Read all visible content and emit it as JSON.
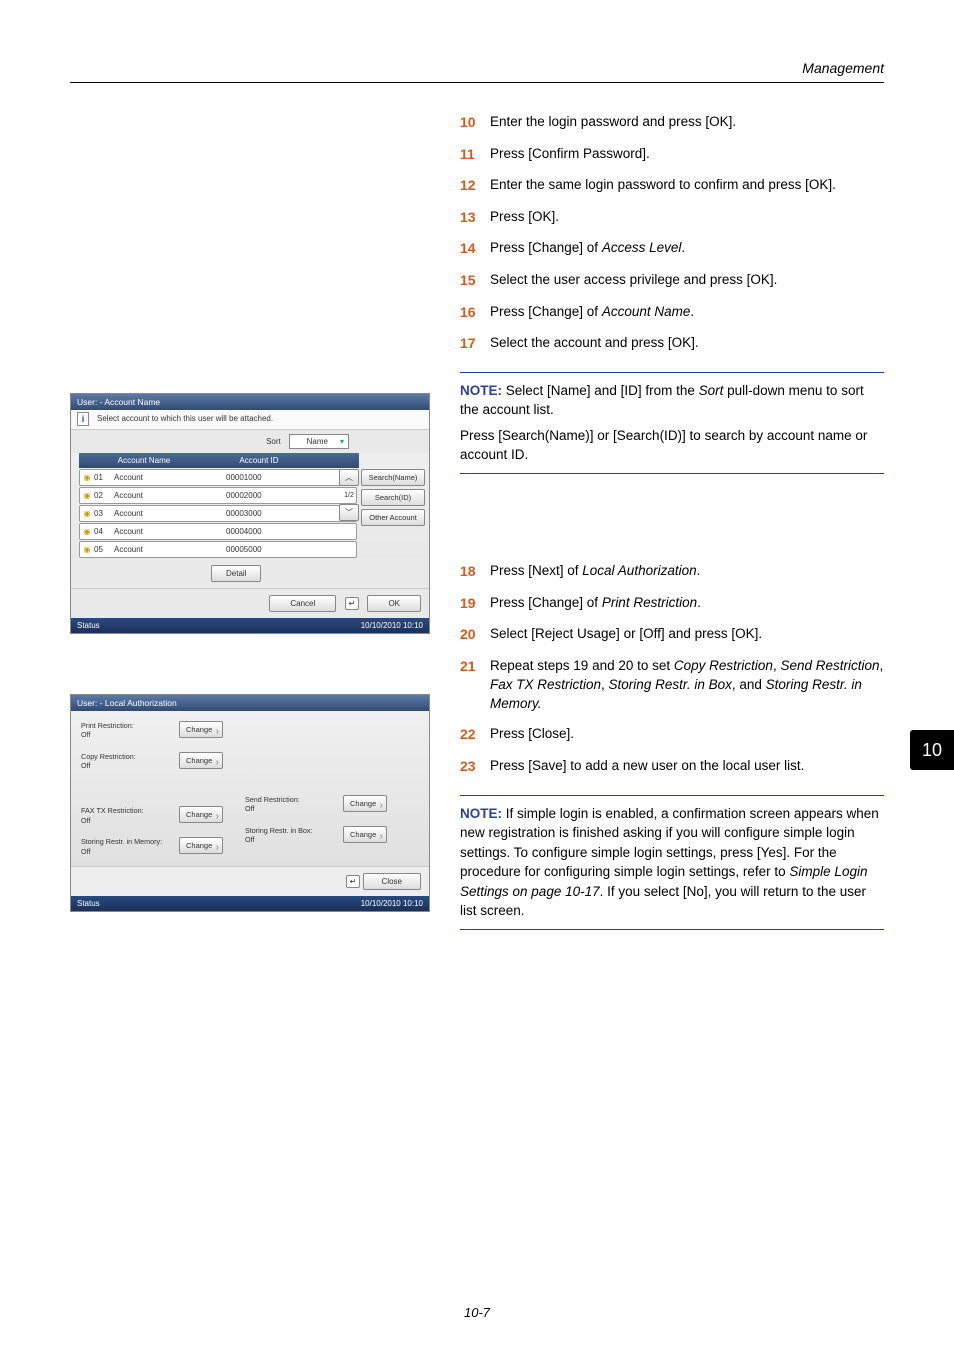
{
  "header": {
    "section": "Management"
  },
  "steps_a": [
    {
      "n": "10",
      "t": "Enter the login password and press [OK]."
    },
    {
      "n": "11",
      "t": "Press [Confirm Password]."
    },
    {
      "n": "12",
      "t": "Enter the same login password to confirm and press [OK]."
    },
    {
      "n": "13",
      "t": "Press [OK]."
    },
    {
      "n": "14",
      "html": "Press [Change] of <span class='italic'>Access Level</span>."
    },
    {
      "n": "15",
      "t": "Select the user access privilege and press [OK]."
    },
    {
      "n": "16",
      "html": "Press [Change] of <span class='italic'>Account Name</span>."
    },
    {
      "n": "17",
      "t": "Select the account and press [OK]."
    }
  ],
  "note1": {
    "label": "NOTE:",
    "l1": "Select [Name] and [ID] from the <span class='italic'>Sort</span> pull-down menu to sort the account list.",
    "l2": "Press [Search(Name)] or [Search(ID)] to search by account name or account ID."
  },
  "steps_b": [
    {
      "n": "18",
      "html": "Press [Next] of <span class='italic'>Local Authorization</span>."
    },
    {
      "n": "19",
      "html": "Press [Change] of <span class='italic'>Print Restriction</span>."
    },
    {
      "n": "20",
      "t": "Select [Reject Usage] or [Off] and press [OK]."
    },
    {
      "n": "21",
      "html": "Repeat steps 19 and 20 to set <span class='italic'>Copy Restriction</span>, <span class='italic'>Send Restriction</span>, <span class='italic'>Fax TX Restriction</span>, <span class='italic'>Storing Restr. in Box</span>, and <span class='italic'>Storing Restr. in Memory.</span>"
    },
    {
      "n": "22",
      "t": "Press [Close]."
    },
    {
      "n": "23",
      "t": "Press [Save] to add a new user on the local user list."
    }
  ],
  "note2": {
    "label": "NOTE:",
    "body": "If simple login is enabled, a confirmation screen appears when new registration is finished asking if you will configure simple login settings. To configure simple login settings, press [Yes]. For the procedure for configuring simple login settings, refer to <span class='italic'>Simple Login Settings on page 10-17</span>. If you select [No], you will return to the user list screen."
  },
  "side_tab": "10",
  "footer": "10-7",
  "dialog1": {
    "title": "User: - Account Name",
    "instruction": "Select account to which this user will be attached.",
    "sort_label": "Sort",
    "sort_value": "Name",
    "col_name": "Account Name",
    "col_id": "Account ID",
    "rows": [
      {
        "num": "01",
        "name": "Account",
        "id": "00001000"
      },
      {
        "num": "02",
        "name": "Account",
        "id": "00002000"
      },
      {
        "num": "03",
        "name": "Account",
        "id": "00003000"
      },
      {
        "num": "04",
        "name": "Account",
        "id": "00004000"
      },
      {
        "num": "05",
        "name": "Account",
        "id": "00005000"
      }
    ],
    "page": "1/2",
    "search_name": "Search(Name)",
    "search_id": "Search(ID)",
    "other_account": "Other Account",
    "detail": "Detail",
    "cancel": "Cancel",
    "ok": "OK",
    "status": "Status",
    "datetime": "10/10/2010   10:10"
  },
  "dialog2": {
    "title": "User: - Local Authorization",
    "items_left": [
      {
        "l1": "Print Restriction:",
        "l2": "Off"
      },
      {
        "l1": "Copy Restriction:",
        "l2": "Off"
      },
      {
        "l1": "FAX TX Restriction:",
        "l2": "Off"
      },
      {
        "l1": "Storing Restr. in Memory:",
        "l2": "Off"
      }
    ],
    "items_right_spacer": true,
    "items_right": [
      {
        "l1": "Send Restriction:",
        "l2": "Off"
      },
      {
        "l1": "Storing Restr. in Box:",
        "l2": "Off"
      }
    ],
    "change": "Change",
    "close": "Close",
    "status": "Status",
    "datetime": "10/10/2010   10:10"
  }
}
